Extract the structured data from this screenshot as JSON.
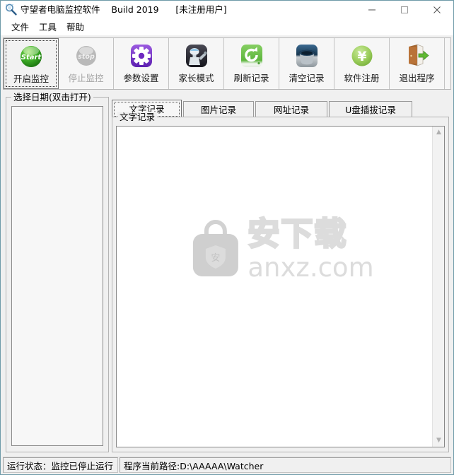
{
  "window": {
    "title": "守望者电脑监控软件    Build 2019      [未注册用户]",
    "icon": "magnifier-icon",
    "border_color": "#6e9aa8",
    "controls": [
      {
        "name": "minimize",
        "glyph": "—"
      },
      {
        "name": "maximize",
        "glyph": "□"
      },
      {
        "name": "close",
        "glyph": "✕"
      }
    ]
  },
  "menu": {
    "items": [
      {
        "label": "文件"
      },
      {
        "label": "工具"
      },
      {
        "label": "帮助"
      }
    ]
  },
  "toolbar": {
    "buttons": [
      {
        "label": "开启监控",
        "icon": "start-icon",
        "state": "focused",
        "icon_color": "#2aa32a"
      },
      {
        "label": "停止监控",
        "icon": "stop-icon",
        "state": "disabled",
        "icon_color": "#b5b5b5"
      },
      {
        "label": "参数设置",
        "icon": "gear-icon",
        "state": "normal",
        "icon_color": "#7b2fd4"
      },
      {
        "label": "家长模式",
        "icon": "robot-icon",
        "state": "normal",
        "icon_color": "#2b2b33"
      },
      {
        "label": "刷新记录",
        "icon": "refresh-icon",
        "state": "normal",
        "icon_color": "#52b552"
      },
      {
        "label": "清空记录",
        "icon": "trash-icon",
        "state": "normal",
        "icon_color": "#2b4a66"
      },
      {
        "label": "软件注册",
        "icon": "yen-icon",
        "state": "normal",
        "icon_color": "#8cc63f"
      },
      {
        "label": "退出程序",
        "icon": "exit-door-icon",
        "state": "normal",
        "icon_color": "#a05a2c"
      }
    ]
  },
  "date_panel": {
    "title": "选择日期(双击打开)",
    "items": []
  },
  "tabs": [
    {
      "label": "文字记录",
      "selected": true
    },
    {
      "label": "图片记录",
      "selected": false
    },
    {
      "label": "网址记录",
      "selected": false
    },
    {
      "label": "U盘插拔记录",
      "selected": false
    }
  ],
  "record_panel": {
    "title": "文字记录",
    "content": "",
    "scrollbar": {
      "up": "▲",
      "down": "▼"
    }
  },
  "watermark": {
    "cn": "安下载",
    "en": "anxz.com",
    "badge": "安",
    "color": "#dcdcdc"
  },
  "statusbar": {
    "run_state": "运行状态：监控已停止运行",
    "path": "程序当前路径:D:\\AAAAA\\Watcher"
  }
}
